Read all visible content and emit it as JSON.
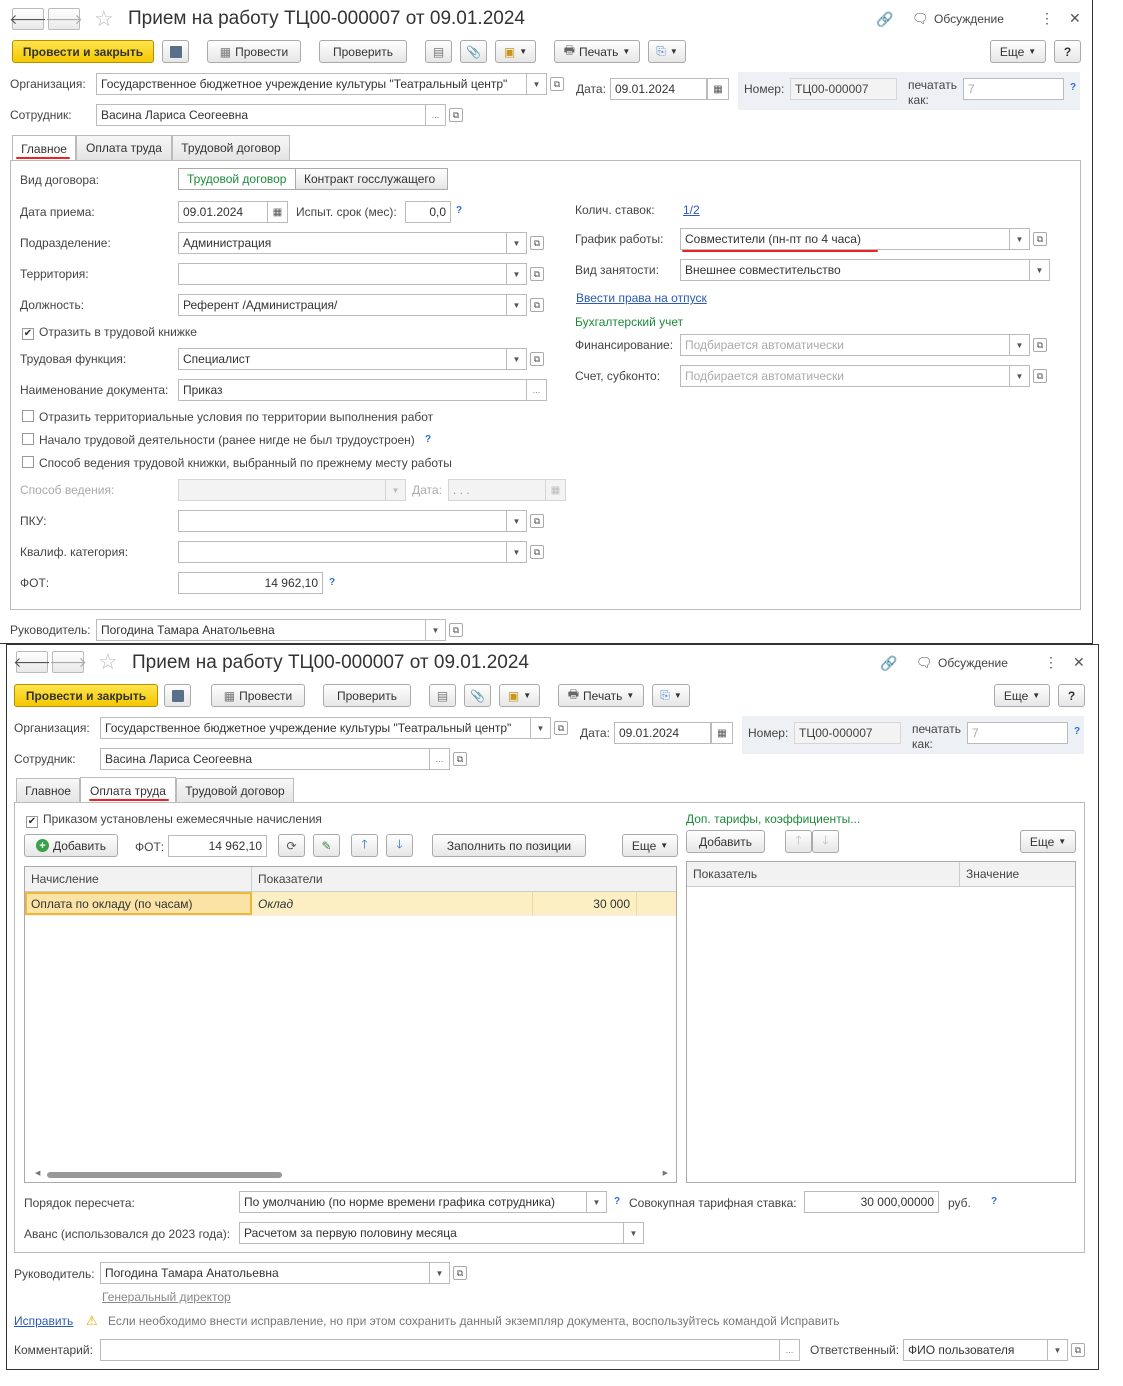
{
  "w1": {
    "title": "Прием на работу ТЦ00-000007 от 09.01.2024",
    "discuss": "Обсуждение",
    "toolbar": {
      "post_close": "Провести и закрыть",
      "post": "Провести",
      "check": "Проверить",
      "print": "Печать",
      "more": "Еще",
      "help": "?"
    },
    "org_label": "Организация:",
    "org_value": "Государственное бюджетное учреждение культуры \"Театральный центр\"",
    "date_label": "Дата:",
    "date_value": "09.01.2024",
    "num_label": "Номер:",
    "num_value": "ТЦ00-000007",
    "print_as_label_1": "печатать",
    "print_as_label_2": "как:",
    "print_as_value": "7",
    "emp_label": "Сотрудник:",
    "emp_value": "Васина Лариса Сеогеевна",
    "tabs": [
      "Главное",
      "Оплата труда",
      "Трудовой договор"
    ],
    "kind_label": "Вид договора:",
    "kind_opt1": "Трудовой договор",
    "kind_opt2": "Контракт госслужащего",
    "hire_date_label": "Дата приема:",
    "hire_date_value": "09.01.2024",
    "probation_label": "Испыт. срок (мес):",
    "probation_value": "0,0",
    "dept_label": "Подразделение:",
    "dept_value": "Администрация",
    "terr_label": "Территория:",
    "terr_value": "",
    "pos_label": "Должность:",
    "pos_value": "Референт /Администрация/",
    "book_label": "Отразить в трудовой книжке",
    "func_label": "Трудовая функция:",
    "func_value": "Специалист",
    "docname_label": "Наименование документа:",
    "docname_value": "Приказ",
    "cb_terr": "Отразить территориальные условия по территории выполнения работ",
    "cb_start": "Начало трудовой деятельности (ранее нигде не был трудоустроен)",
    "cb_method": "Способ ведения трудовой книжки, выбранный по прежнему месту работы",
    "method_label": "Способ ведения:",
    "method_date_label": "Дата:",
    "method_date_value": ". . .",
    "pku_label": "ПКУ:",
    "pku_value": "",
    "qual_label": "Квалиф. категория:",
    "qual_value": "",
    "fot_label": "ФОТ:",
    "fot_value": "14 962,10",
    "rates_label": "Колич. ставок:",
    "rates_value": "1/2",
    "sched_label": "График работы:",
    "sched_value": "Совместители (пн-пт по 4 часа)",
    "empl_label": "Вид занятости:",
    "empl_value": "Внешнее совместительство",
    "vac_link": "Ввести права на отпуск",
    "acc_header": "Бухгалтерский учет",
    "fin_label": "Финансирование:",
    "fin_ph": "Подбирается автоматически",
    "acct_label": "Счет, субконто:",
    "acct_ph": "Подбирается автоматически",
    "head_label": "Руководитель:",
    "head_value": "Погодина Тамара Анатольевна"
  },
  "w2": {
    "title": "Прием на работу ТЦ00-000007 от 09.01.2024",
    "discuss": "Обсуждение",
    "toolbar": {
      "post_close": "Провести и закрыть",
      "post": "Провести",
      "check": "Проверить",
      "print": "Печать",
      "more": "Еще",
      "help": "?"
    },
    "org_label": "Организация:",
    "org_value": "Государственное бюджетное учреждение культуры \"Театральный центр\"",
    "date_label": "Дата:",
    "date_value": "09.01.2024",
    "num_label": "Номер:",
    "num_value": "ТЦ00-000007",
    "print_as_label_1": "печатать",
    "print_as_label_2": "как:",
    "print_as_value": "7",
    "emp_label": "Сотрудник:",
    "emp_value": "Васина Лариса Сеогеевна",
    "tabs": [
      "Главное",
      "Оплата труда",
      "Трудовой договор"
    ],
    "monthly_label": "Приказом установлены ежемесячные начисления",
    "add_label": "Добавить",
    "fot_label": "ФОТ:",
    "fot_value": "14 962,10",
    "fill_label": "Заполнить по позиции",
    "more": "Еще",
    "col_accrual": "Начисление",
    "col_indicators": "Показатели",
    "row_accrual": "Оплата по окладу (по часам)",
    "row_indicator": "Оклад",
    "row_value": "30 000",
    "tariffs_link": "Доп. тарифы, коэффициенты...",
    "add2_label": "Добавить",
    "more2": "Еще",
    "col_indicator": "Показатель",
    "col_value": "Значение",
    "recalc_label": "Порядок пересчета:",
    "recalc_value": "По умолчанию (по норме времени графика сотрудника)",
    "rate_label": "Совокупная тарифная ставка:",
    "rate_value": "30 000,00000",
    "rate_unit": "руб.",
    "advance_label": "Аванс (использовался до 2023 года):",
    "advance_value": "Расчетом за первую половину месяца",
    "head_label": "Руководитель:",
    "head_value": "Погодина Тамара Анатольевна",
    "head_pos": "Генеральный директор",
    "fix_link": "Исправить",
    "fix_note": "Если необходимо внести исправление, но при этом сохранить данный экземпляр документа, воспользуйтесь командой Исправить",
    "comment_label": "Комментарий:",
    "comment_value": "",
    "resp_label": "Ответственный:",
    "resp_value": "ФИО пользователя"
  }
}
